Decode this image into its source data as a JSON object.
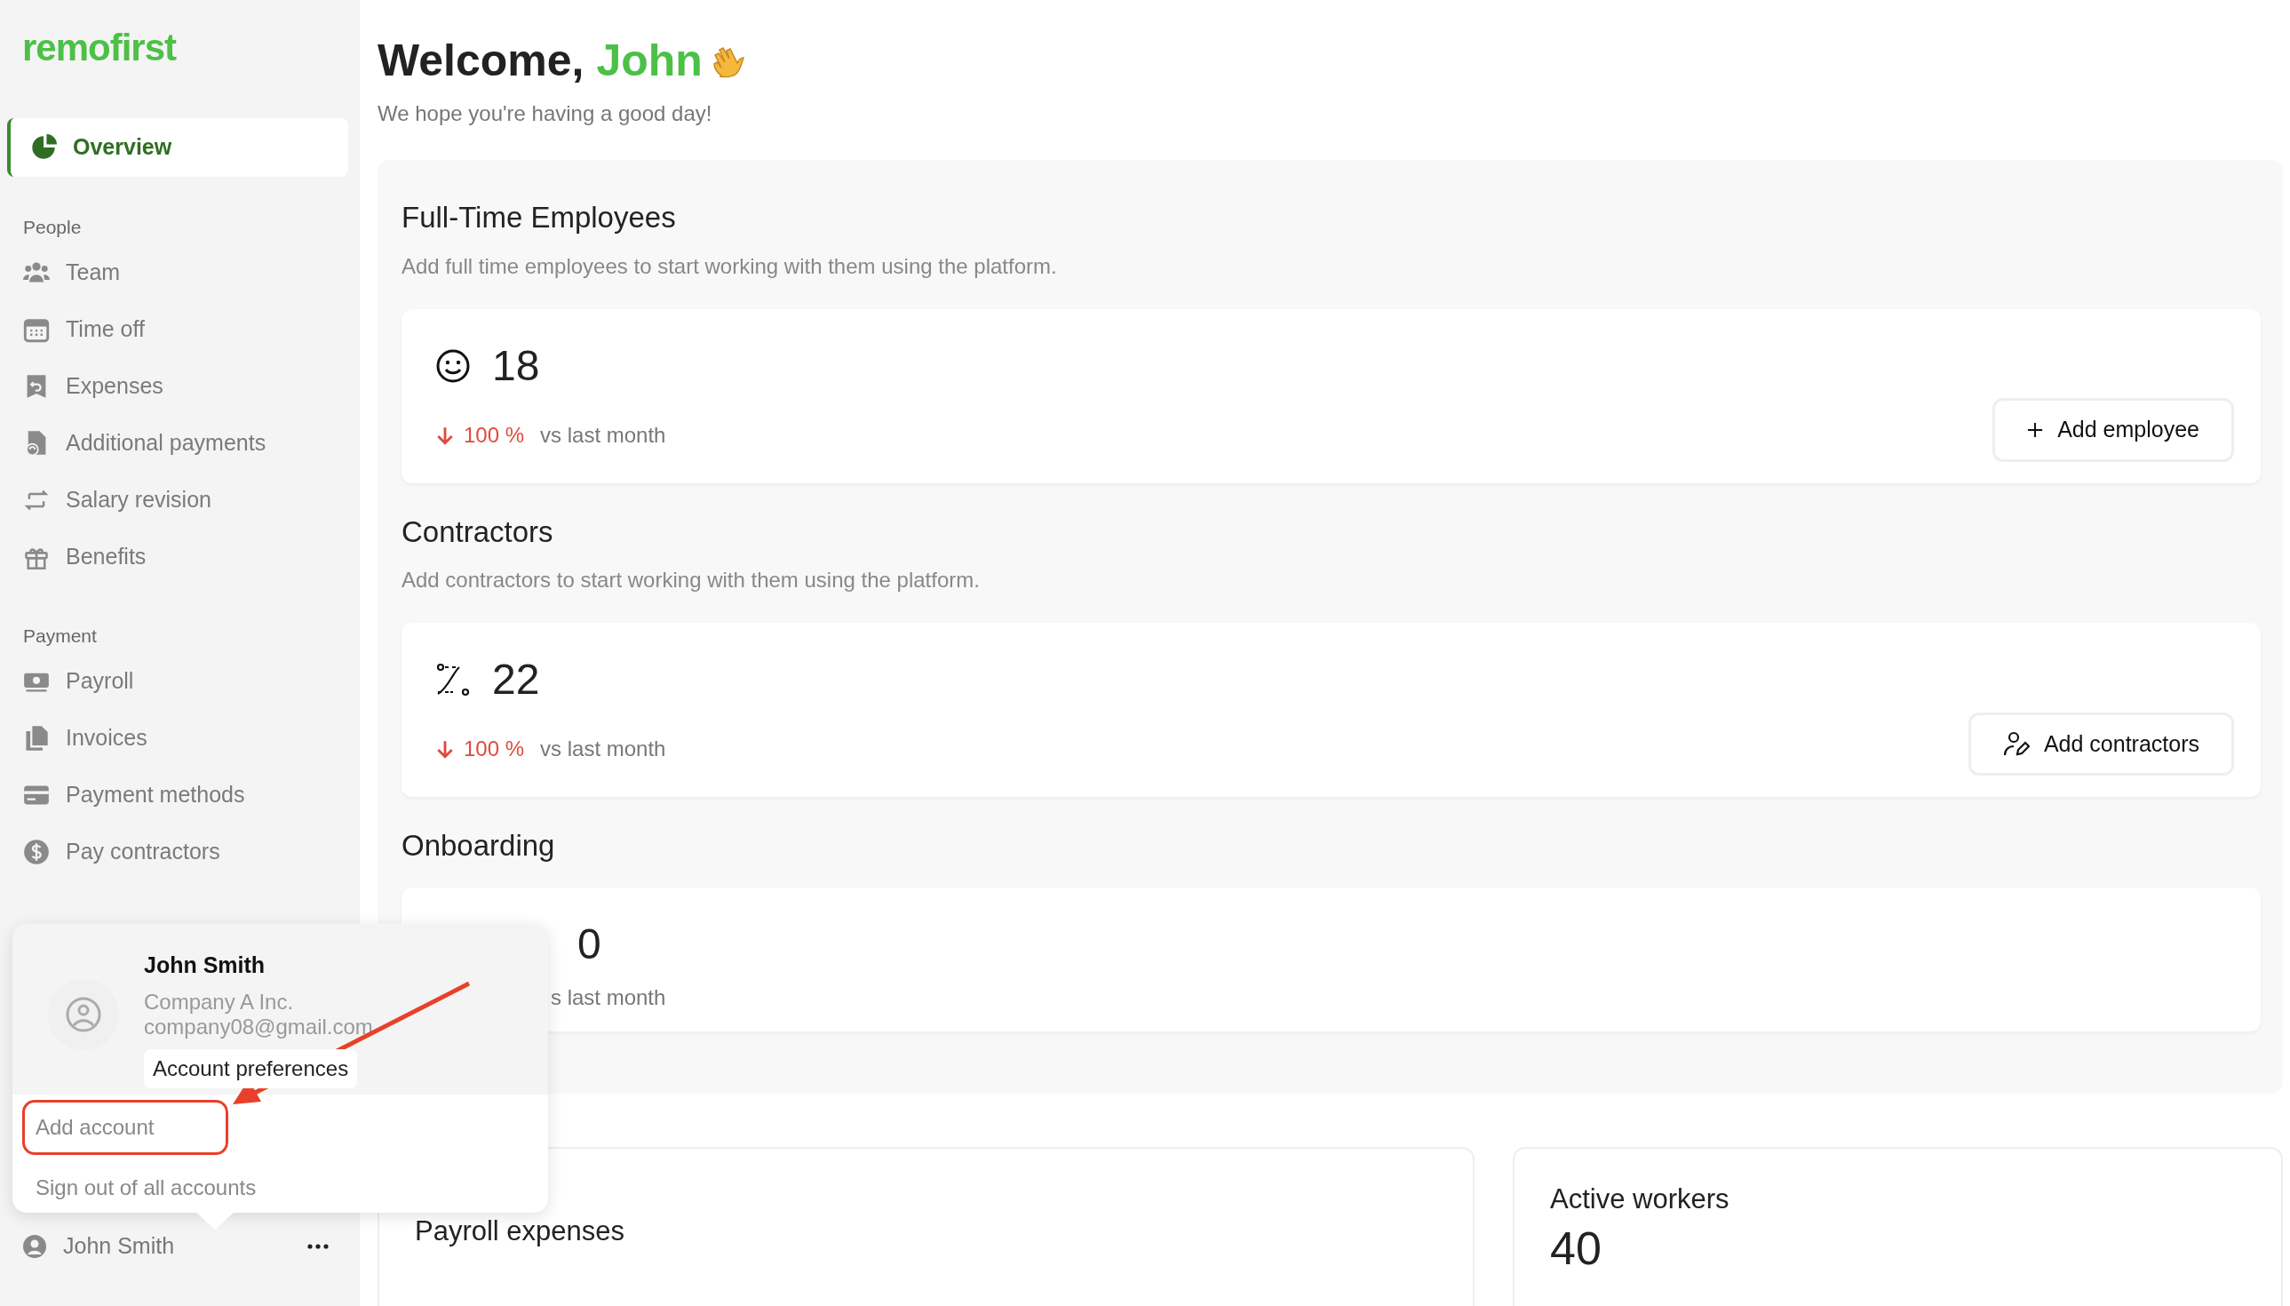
{
  "sidebar": {
    "logo": "remofirst",
    "items": [
      {
        "kind": "nav",
        "label": "Overview",
        "selected": true
      },
      {
        "kind": "heading",
        "label": "People"
      },
      {
        "kind": "nav",
        "label": "Team",
        "selected": false
      },
      {
        "kind": "nav",
        "label": "Time off",
        "selected": false
      },
      {
        "kind": "nav",
        "label": "Expenses",
        "selected": false
      },
      {
        "kind": "nav",
        "label": "Additional payments",
        "selected": false
      },
      {
        "kind": "nav",
        "label": "Salary revision",
        "selected": false
      },
      {
        "kind": "nav",
        "label": "Benefits",
        "selected": false
      },
      {
        "kind": "heading",
        "label": "Payment"
      },
      {
        "kind": "nav",
        "label": "Payroll",
        "selected": false
      },
      {
        "kind": "nav",
        "label": "Invoices",
        "selected": false
      },
      {
        "kind": "nav",
        "label": "Payment methods",
        "selected": false
      },
      {
        "kind": "nav",
        "label": "Pay contractors",
        "selected": false
      }
    ],
    "user": {
      "name": "John Smith"
    }
  },
  "welcome": {
    "greeting": "Welcome,",
    "name": "John",
    "subtitle": "We hope you're having a good day!"
  },
  "sections": [
    {
      "title": "Full-Time Employees",
      "description": "Add full time employees to start working with them using the platform.",
      "stat": {
        "value": "18",
        "change": "100 %",
        "comparison": "vs last month"
      },
      "button": {
        "label": "Add employee"
      }
    },
    {
      "title": "Contractors",
      "description": "Add contractors to start working with them using the platform.",
      "stat": {
        "value": "22",
        "change": "100 %",
        "comparison": "vs last month"
      },
      "button": {
        "label": "Add contractors"
      }
    },
    {
      "title": "Onboarding",
      "stat": {
        "value": "0",
        "comparison": "s last month"
      }
    }
  ],
  "widgets": [
    {
      "title": "Payroll expenses"
    },
    {
      "title": "Active workers",
      "value": "40"
    }
  ],
  "account_menu": {
    "name": "John Smith",
    "company": "Company A Inc.",
    "email": "company08@gmail.com",
    "preferences_button": "Account preferences",
    "actions": [
      {
        "label": "Add account",
        "highlighted": true
      },
      {
        "label": "Sign out of all accounts",
        "highlighted": false
      }
    ]
  }
}
